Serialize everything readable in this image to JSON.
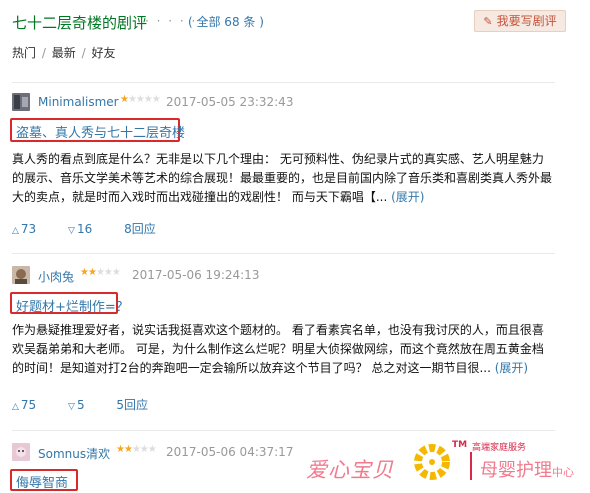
{
  "header": {
    "title": "七十二层奇楼的剧评",
    "dots": "· · · · · ·",
    "count": "( 全部 68 条 )",
    "write_button": "我要写剧评"
  },
  "sort": {
    "hot": "热门",
    "latest": "最新",
    "friends": "好友",
    "sep": "/"
  },
  "reviews": [
    {
      "user": "Minimalismer",
      "stars": 1,
      "time": "2017-05-05 23:32:43",
      "title": "盗墓、真人秀与七十二层奇楼",
      "body": "真人秀的看点到底是什么？无非是以下几个理由： 无可预料性、伪纪录片式的真实感、艺人明星魅力的展示、音乐文学美术等艺术的综合展现！最最重要的，也是目前国内除了音乐类和喜剧类真人秀外最大的卖点，就是时而入戏时而出戏碰撞出的戏剧性！ 而与天下霸唱【...",
      "expand": "(展开)",
      "up": "73",
      "down": "16",
      "replies": "8回应"
    },
    {
      "user": "小肉兔",
      "stars": 2,
      "time": "2017-05-06 19:24:13",
      "title": "好题材+烂制作=？",
      "body": "作为悬疑推理爱好者，说实话我挺喜欢这个题材的。 看了看素宾名单，也没有我讨厌的人，而且很喜欢吴磊弟弟和大老师。 可是，为什么制作这么烂呢？明星大侦探做网综，而这个竟然放在周五黄金档的时间！是知道对打2台的奔跑吧一定会输所以放弃这个节目了吗？ 总之对这一期节目很...",
      "expand": "(展开)",
      "up": "75",
      "down": "5",
      "replies": "5回应"
    },
    {
      "user": "Somnus清欢",
      "stars": 2,
      "time": "2017-05-06 04:37:17",
      "title": "侮辱智商"
    }
  ],
  "watermark": {
    "left_text": "爱心宝贝",
    "tm": "TM",
    "sub": "高端家庭服务",
    "right_text": "母婴护理",
    "right_small": "中心"
  },
  "colors": {
    "title_green": "#007722",
    "link_blue": "#3377aa",
    "highlight_red": "#d82a2a",
    "star_orange": "#f5a623",
    "logo_pink": "#f07a8e"
  }
}
